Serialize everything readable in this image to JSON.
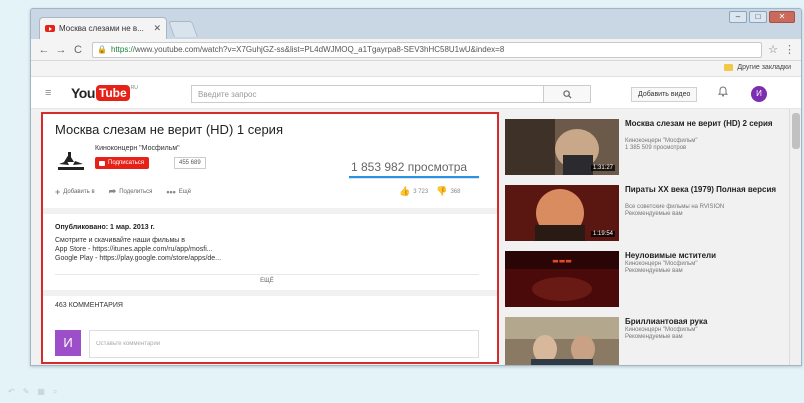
{
  "browser": {
    "tab_title": "Москва слезами не в...",
    "tab_close": "✕",
    "url_secure": "https://",
    "url_rest": "www.youtube.com/watch?v=X7GuhjGZ-ss&list=PL4dWJMOQ_a1Tgayrpa8-SEV3hHC58U1wU&index=8",
    "bookmarks_label": "Другие закладки",
    "colors": {
      "tab_strip": "#c9d6e4",
      "secure": "#1a7f37"
    }
  },
  "yt": {
    "logo_you": "You",
    "logo_tube": "Tube",
    "logo_region": "RU",
    "search_placeholder": "Введите запрос",
    "upload_label": "Добавить видео",
    "user_initial": "И",
    "brand_color": "#e62117"
  },
  "video": {
    "title": "Москва слезам не верит (HD) 1 серия",
    "channel": "Киноконцерн \"Мосфильм\"",
    "subscribe_label": "Подписаться",
    "subscribers": "455 689",
    "views": "1 853 982 просмотра",
    "actions": {
      "add": "Добавить в",
      "share": "Поделиться",
      "more": "Ещё"
    },
    "likes": "3 723",
    "dislikes": "368",
    "published": "Опубликовано: 1 мар. 2013 г.",
    "description": [
      "Смотрите и скачивайте наши фильмы в",
      "App Store - https://itunes.apple.com/ru/app/mosfi...",
      "Google Play - https://play.google.com/store/apps/de..."
    ],
    "show_more": "ЕЩЁ",
    "comments_count": "463 КОММЕНТАРИЯ",
    "comment_placeholder": "Оставьте комментарий",
    "commenter_initial": "И"
  },
  "sidebar": [
    {
      "title": "Москва слезам не верит (HD) 2 серия",
      "channel": "Киноконцерн \"Мосфильм\"",
      "meta": "1 385 509 просмотров",
      "duration": "1:31:27"
    },
    {
      "title": "Пираты XX века (1979) Полная версия",
      "channel": "Все советские фильмы на RVISION",
      "meta": "Рекомендуемые вам",
      "duration": "1:19:54"
    },
    {
      "title": "Неуловимые мстители",
      "channel": "Киноконцерн \"Мосфильм\"",
      "meta": "Рекомендуемые вам",
      "duration": ""
    },
    {
      "title": "Бриллиантовая рука",
      "channel": "Киноконцерн \"Мосфильм\"",
      "meta": "Рекомендуемые вам",
      "duration": ""
    }
  ]
}
